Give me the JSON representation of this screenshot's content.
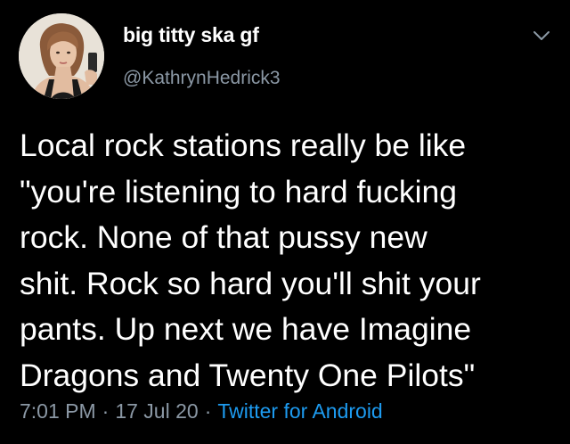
{
  "tweet": {
    "display_name": "big titty ska gf",
    "handle": "@KathrynHedrick3",
    "text_lines": [
      "Local rock stations really be like",
      "\"you're listening to hard fucking",
      "rock. None of that pussy new",
      "shit. Rock so hard you'll shit your",
      "pants. Up next we have Imagine",
      "Dragons and Twenty One Pilots\""
    ],
    "time": "7:01 PM",
    "date": "17 Jul 20",
    "source": "Twitter for Android",
    "separator": "·"
  },
  "icons": {
    "more_menu": "chevron-down-icon"
  },
  "colors": {
    "background": "#000000",
    "text": "#ffffff",
    "secondary_text": "#8b98a5",
    "link": "#1d9bf0"
  }
}
